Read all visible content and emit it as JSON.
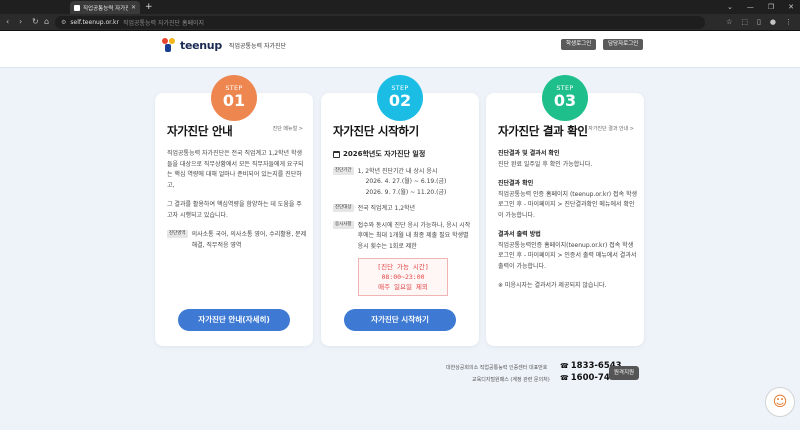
{
  "browser": {
    "tab_title": "직업공통능력 자가진단 홈페이지",
    "new_tab": "+",
    "url": "self.teenup.or.kr",
    "page_title_hint": "직업공통능력 자가진단 홈페이지"
  },
  "header": {
    "logo_text": "teenup",
    "logo_sub": "직업공통능력 자가진단",
    "student_login": "학생로그인",
    "staff_login": "담당자로그인"
  },
  "cards": [
    {
      "step_label": "STEP",
      "step_num": "01",
      "color": "#ee8650",
      "title": "자가진단 안내",
      "link": "진단 메뉴얼 >",
      "paragraphs": [
        "직업공통능력 자가진단은 전국 직업계고 1,2학년 학생들을 대상으로 직무상황에서 모든 직무자들에게 요구되는 핵심 역량에 대해 얼마나 준비되어 있는지를 진단하고,",
        "그 결과를 활용하여 핵심역량을 함양하는 데 도움을 주고자 시행되고 있습니다."
      ],
      "tag": "진단영역",
      "tag_text": "의사소통 국어, 의사소통 영어, 수리활용, 문제해결, 직무적응 영역",
      "button": "자가진단 안내(자세히)"
    },
    {
      "step_label": "STEP",
      "step_num": "02",
      "color": "#1bbde4",
      "title": "자가진단 시작하기",
      "schedule_title": "2026학년도 자가진단 일정",
      "rows": [
        {
          "tag": "진단기간",
          "text": "1, 2학년 진단기간 내 상시 응시",
          "dates": [
            "2026. 4. 27.(월) ~ 6.19.(금)",
            "2026. 9. 7.(월) ~ 11.20.(금)"
          ]
        },
        {
          "tag": "진단대상",
          "text": "전국 직업계고 1,2학년"
        },
        {
          "tag": "응시사항",
          "text": "접수와 동시에 진단 응시 가능하나, 응시 시작 후에는 최대 1개월 내 최종 제출 필요 학생별 응시 횟수는 1회로 제한"
        }
      ],
      "notice": [
        "[진단 가능 시간]",
        "08:00~23:00",
        "매주 일요일 제외"
      ],
      "button": "자가진단 시작하기"
    },
    {
      "step_label": "STEP",
      "step_num": "03",
      "color": "#1fbf8c",
      "title": "자가진단 결과 확인",
      "link": "자가진단 결과 안내 >",
      "blocks": [
        {
          "h": "진단결과 및 결과서 확인",
          "t": "진단 완료 일주일 후 확인 가능합니다."
        },
        {
          "h": "진단결과 확인",
          "t": "직업공통능력 인증 홈페이지 (teenup.or.kr) 접속 학생 로그인 후 - 마이페이지 > 진단결과확인 메뉴에서 확인이 가능합니다."
        },
        {
          "h": "결과서 출력 방법",
          "t": "직업공통능력인증 홈페이지(teenup.or.kr) 접속 학생 로그인 후 - 마이페이지 > 인증서 출력 메뉴에서 결과서 출력이 가능합니다."
        },
        {
          "h": "",
          "t": "※ 미응시자는 결과서가 제공되지 않습니다."
        }
      ]
    }
  ],
  "footer": {
    "line1": "대한상공회의소 직업공통능력 인증센터 대표번호",
    "phone1": "1833-6543",
    "line2": "교육디지털원패스 (계정 관련 문의처)",
    "phone2": "1600-7440",
    "remote": "원격지원"
  }
}
